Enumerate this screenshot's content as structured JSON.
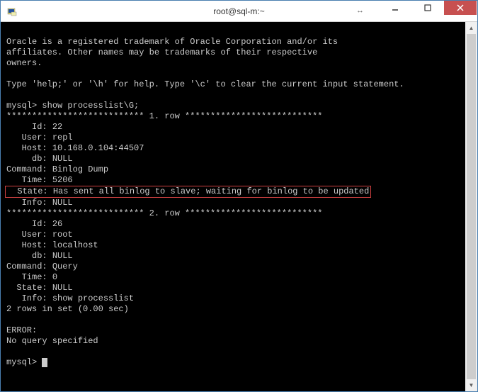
{
  "titlebar": {
    "title": "root@sql-m:~"
  },
  "terminal": {
    "intro_line1": "Oracle is a registered trademark of Oracle Corporation and/or its",
    "intro_line2": "affiliates. Other names may be trademarks of their respective",
    "intro_line3": "owners.",
    "help_line": "Type 'help;' or '\\h' for help. Type '\\c' to clear the current input statement.",
    "prompt": "mysql>",
    "command": "show processlist\\G;",
    "row1_header": "*************************** 1. row ***************************",
    "row2_header": "*************************** 2. row ***************************",
    "labels": {
      "id": "     Id:",
      "user": "   User:",
      "host": "   Host:",
      "db": "     db:",
      "command": "Command:",
      "time": "   Time:",
      "state": "  State:",
      "info": "   Info:"
    },
    "row1": {
      "id": "22",
      "user": "repl",
      "host": "10.168.0.104:44507",
      "db": "NULL",
      "command": "Binlog Dump",
      "time": "5206",
      "state": "Has sent all binlog to slave; waiting for binlog to be updated",
      "info": "NULL"
    },
    "row2": {
      "id": "26",
      "user": "root",
      "host": "localhost",
      "db": "NULL",
      "command": "Query",
      "time": "0",
      "state": "NULL",
      "info": "show processlist"
    },
    "result_line": "2 rows in set (0.00 sec)",
    "error_label": "ERROR:",
    "error_msg": "No query specified"
  }
}
